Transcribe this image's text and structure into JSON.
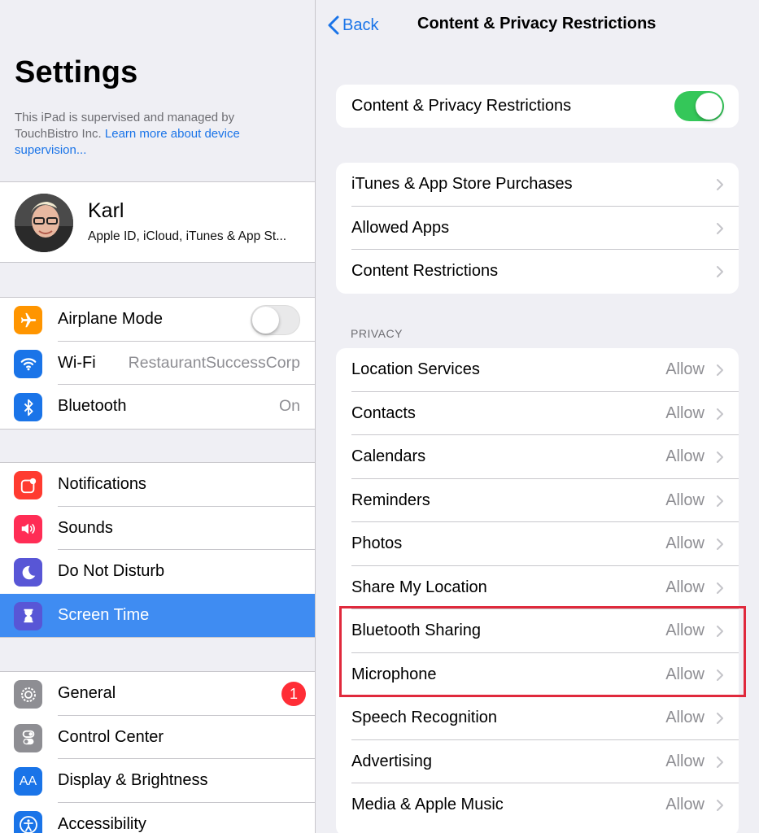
{
  "left": {
    "title": "Settings",
    "supervision_text": "This iPad is supervised and managed by TouchBistro Inc. ",
    "supervision_link": "Learn more about device supervision...",
    "profile": {
      "name": "Karl",
      "subtitle": "Apple ID, iCloud, iTunes & App St..."
    },
    "group1": [
      {
        "label": "Airplane Mode",
        "icon": "airplane-icon",
        "color": "#ff9500",
        "control": "toggle-off"
      },
      {
        "label": "Wi-Fi",
        "icon": "wifi-icon",
        "color": "#1a74e8",
        "value": "RestaurantSuccessCorp"
      },
      {
        "label": "Bluetooth",
        "icon": "bluetooth-icon",
        "color": "#1a74e8",
        "value": "On"
      }
    ],
    "group2": [
      {
        "label": "Notifications",
        "icon": "notifications-icon",
        "color": "#ff3b30"
      },
      {
        "label": "Sounds",
        "icon": "sounds-icon",
        "color": "#ff2d55"
      },
      {
        "label": "Do Not Disturb",
        "icon": "moon-icon",
        "color": "#5856d6"
      },
      {
        "label": "Screen Time",
        "icon": "hourglass-icon",
        "color": "#5856d6",
        "selected": true
      }
    ],
    "group3": [
      {
        "label": "General",
        "icon": "gear-icon",
        "color": "#8e8e93",
        "badge": "1"
      },
      {
        "label": "Control Center",
        "icon": "control-center-icon",
        "color": "#8e8e93"
      },
      {
        "label": "Display & Brightness",
        "icon": "display-icon",
        "color": "#1a74e8",
        "icon_text": "AA"
      },
      {
        "label": "Accessibility",
        "icon": "accessibility-icon",
        "color": "#1a74e8"
      }
    ]
  },
  "right": {
    "back_label": "Back",
    "nav_title": "Content & Privacy Restrictions",
    "master_toggle_label": "Content & Privacy Restrictions",
    "store_group": [
      {
        "label": "iTunes & App Store Purchases"
      },
      {
        "label": "Allowed Apps"
      },
      {
        "label": "Content Restrictions"
      }
    ],
    "privacy_header": "PRIVACY",
    "privacy_items": [
      {
        "label": "Location Services",
        "value": "Allow"
      },
      {
        "label": "Contacts",
        "value": "Allow"
      },
      {
        "label": "Calendars",
        "value": "Allow"
      },
      {
        "label": "Reminders",
        "value": "Allow"
      },
      {
        "label": "Photos",
        "value": "Allow"
      },
      {
        "label": "Share My Location",
        "value": "Allow"
      },
      {
        "label": "Bluetooth Sharing",
        "value": "Allow"
      },
      {
        "label": "Microphone",
        "value": "Allow"
      },
      {
        "label": "Speech Recognition",
        "value": "Allow"
      },
      {
        "label": "Advertising",
        "value": "Allow"
      },
      {
        "label": "Media & Apple Music",
        "value": "Allow"
      }
    ],
    "highlight_color": "#e0293c"
  },
  "colors": {
    "accent": "#1a74e8",
    "toggle_on": "#34c759",
    "selected_row": "#3f8cf2",
    "badge": "#ff2d36"
  }
}
